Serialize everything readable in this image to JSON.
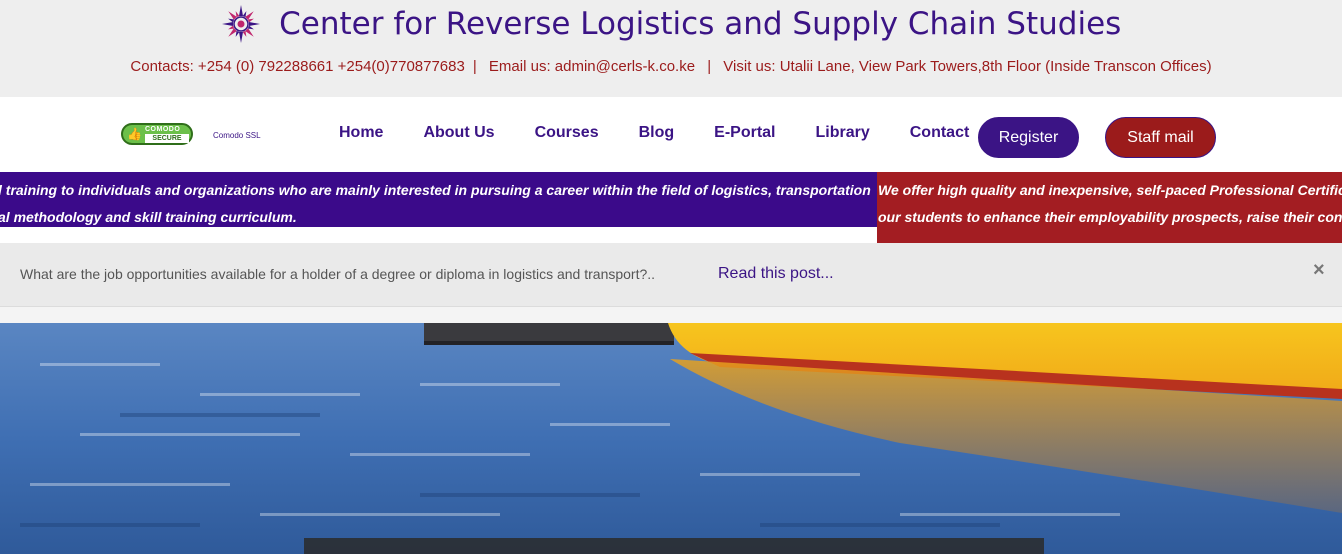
{
  "site": {
    "title": "Center for Reverse Logistics and Supply Chain Studies",
    "logo": "compass-logo-icon"
  },
  "contacts": {
    "phones": "Contacts: +254 (0) 792288661   +254(0)770877683",
    "sep1": "|",
    "email": "Email us: admin@cerls-k.co.ke",
    "sep2": "|",
    "visit": "Visit us: Utalii Lane, View Park Towers,8th Floor (Inside Transcon Offices)"
  },
  "badge": {
    "brand": "COMODO",
    "secure": "SECURE",
    "label": "Comodo SSL",
    "icon": "thumbs-up-icon"
  },
  "nav": {
    "items": [
      {
        "label": "Home"
      },
      {
        "label": "About Us"
      },
      {
        "label": "Courses"
      },
      {
        "label": "Blog"
      },
      {
        "label": "E-Portal"
      },
      {
        "label": "Library"
      },
      {
        "label": "Contact"
      }
    ],
    "register": "Register",
    "staff_mail": "Staff mail"
  },
  "marquee": {
    "purple_line1": "l training to individuals and organizations who are mainly interested in pursuing a career within the field of logistics, transportation",
    "purple_line2": "al methodology and skill training curriculum.",
    "red_line1": "We offer high quality and inexpensive, self-paced Professional Certific",
    "red_line2": "our students to enhance their employability prospects, raise their conf"
  },
  "notice": {
    "text": "What are the job opportunities available for a holder of a degree or diploma in logistics and transport?..",
    "link": "Read this post...",
    "close": "×"
  },
  "colors": {
    "brand_purple": "#3b1485",
    "brand_red": "#9b1b1b",
    "band_purple": "#3b0a8a",
    "band_red": "#a31d22"
  }
}
